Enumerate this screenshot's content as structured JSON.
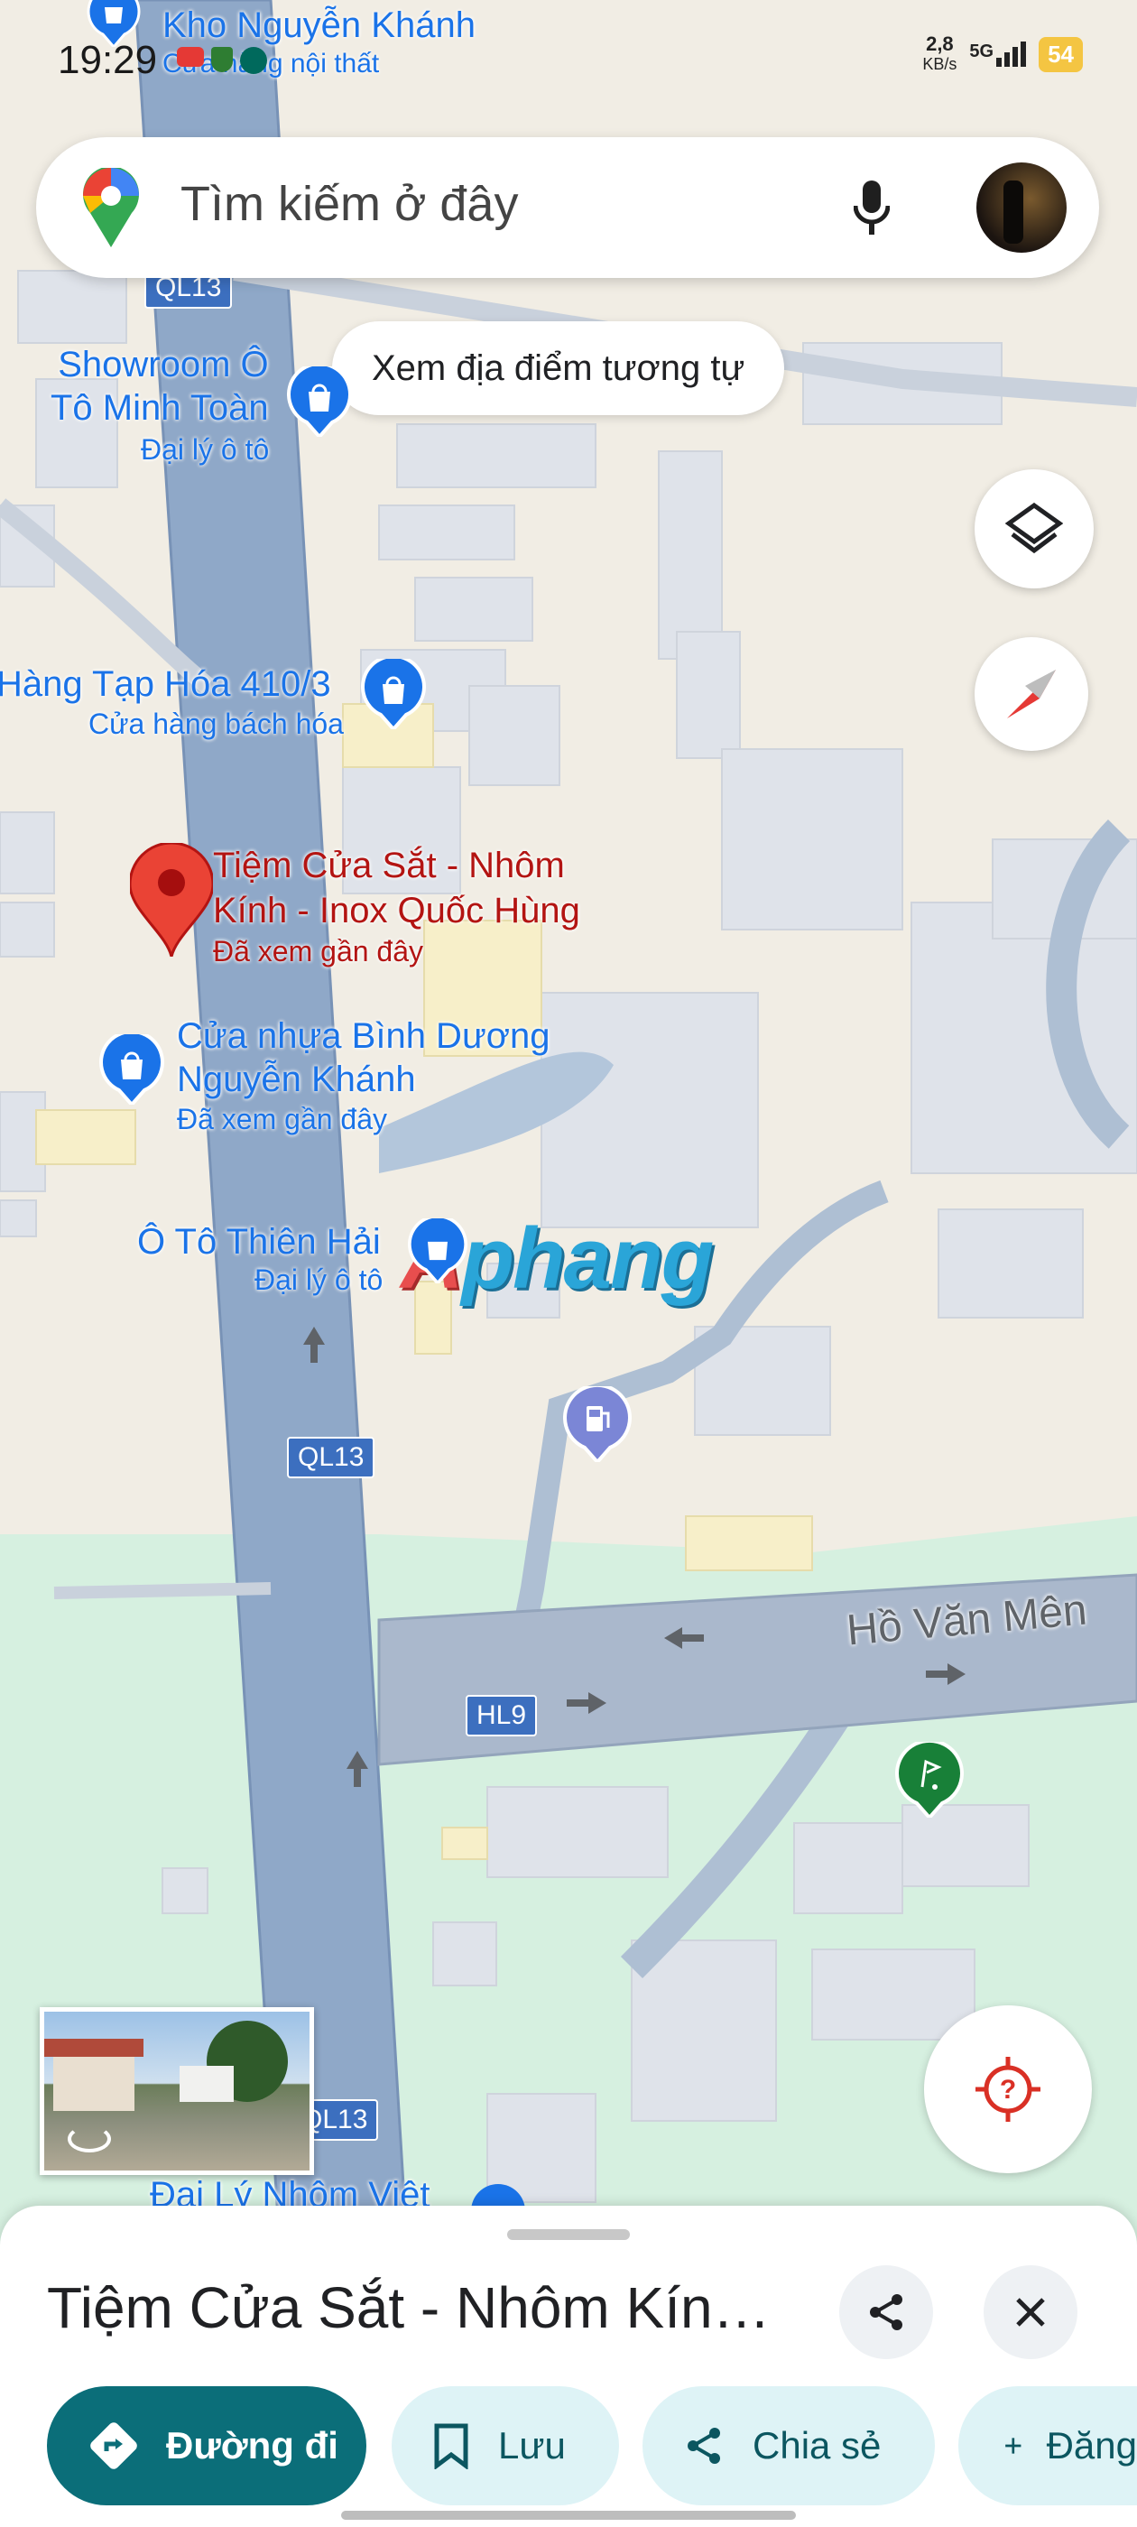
{
  "status_bar": {
    "time": "19:29",
    "net_speed": "2,8",
    "net_unit": "KB/s",
    "network": "5G",
    "battery": "54"
  },
  "search": {
    "placeholder": "Tìm kiếm ở đây"
  },
  "chip": {
    "label": "Xem địa điểm tương tự"
  },
  "map": {
    "places": [
      {
        "name": "Kho Nguyễn Khánh",
        "sub": "Cửa hàng nội thất"
      },
      {
        "name_line1": "Showroom Ô",
        "name_line2": "Tô Minh Toàn",
        "sub": "Đại lý ô tô"
      },
      {
        "name": "Hàng Tạp Hóa 410/3",
        "sub": "Cửa hàng bách hóa"
      },
      {
        "name_line1": "Cửa nhựa Bình Dương",
        "name_line2": "Nguyễn Khánh",
        "sub": "Đã xem gần đây"
      },
      {
        "name": "Ô Tô Thiên Hải",
        "sub": "Đại lý ô tô"
      },
      {
        "name": "Đại Lý Nhôm Việt"
      }
    ],
    "selected_place": {
      "name_line1": "Tiệm Cửa Sắt - Nhôm",
      "name_line2": "Kính - Inox Quốc Hùng",
      "sub": "Đã xem gần đây"
    },
    "road_labels": [
      "QL13",
      "QL13",
      "QL13",
      "HL9"
    ],
    "street_name": "Hồ Văn Mên",
    "watermark": {
      "first": "A",
      "rest": "phang"
    }
  },
  "sheet": {
    "title": "Tiệm Cửa Sắt - Nhôm Kính - Inox Quốc Hùng",
    "actions": [
      {
        "label": "Đường đi",
        "icon": "directions-icon"
      },
      {
        "label": "Lưu",
        "icon": "bookmark-icon"
      },
      {
        "label": "Chia sẻ",
        "icon": "share-icon"
      },
      {
        "label": "Đăng",
        "icon": "plus-icon"
      }
    ]
  },
  "colors": {
    "accent": "#0b6e79",
    "pin_red": "#ea4335",
    "poi_blue": "#1a73e8",
    "road": "#8fa8c8"
  }
}
